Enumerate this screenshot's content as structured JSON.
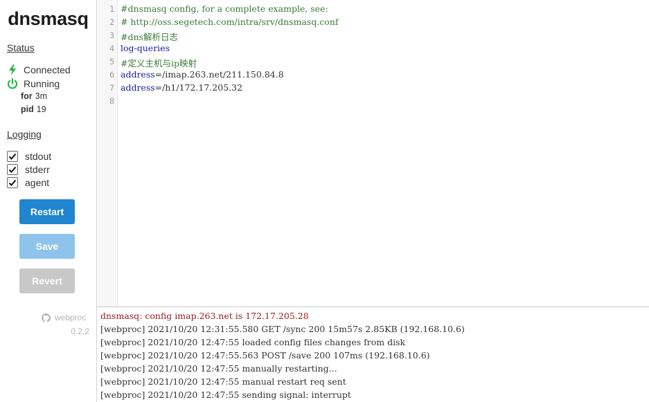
{
  "app": {
    "title": "dnsmasq"
  },
  "status": {
    "heading": "Status",
    "connected": "Connected",
    "running": "Running",
    "for_label": "for",
    "for_value": "3m",
    "pid_label": "pid",
    "pid_value": "19"
  },
  "logging": {
    "heading": "Logging",
    "options": [
      {
        "label": "stdout",
        "checked": true
      },
      {
        "label": "stderr",
        "checked": true
      },
      {
        "label": "agent",
        "checked": true
      }
    ]
  },
  "buttons": {
    "restart": "Restart",
    "save": "Save",
    "revert": "Revert"
  },
  "footer": {
    "brand": "webproc",
    "version": "0.2.2"
  },
  "colors": {
    "primary": "#2185d0",
    "primary_disabled": "#8ec4ec",
    "disabled": "#c8c8c8",
    "connected_icon": "#21ba45",
    "running_icon": "#21ba45"
  },
  "editor": {
    "line_numbers": [
      "1",
      "2",
      "3",
      "4",
      "5",
      "6",
      "7",
      "8"
    ],
    "lines": {
      "l1": "#dnsmasq config, for a complete example, see:",
      "l2": "# http://oss.segetech.com/intra/srv/dnsmasq.conf",
      "l3": "#dns解析日志",
      "l4": "log-queries",
      "l5": "#定义主机与ip映射",
      "l6_key": "address",
      "l6_val": "=/imap.263.net/211.150.84.8",
      "l7_key": "address",
      "l7_val": "=/h1/172.17.205.32",
      "l8": ""
    }
  },
  "log": {
    "lines": [
      "dnsmasq: config imap.263.net is 172.17.205.28",
      "[webproc] 2021/10/20 12:31:55.580 GET /sync 200 15m57s 2.85KB (192.168.10.6)",
      "[webproc] 2021/10/20 12:47:55 loaded config files changes from disk",
      "[webproc] 2021/10/20 12:47:55.563 POST /save 200 107ms (192.168.10.6)",
      "[webproc] 2021/10/20 12:47:55 manually restarting...",
      "[webproc] 2021/10/20 12:47:55 manual restart req sent",
      "[webproc] 2021/10/20 12:47:55 sending signal: interrupt"
    ]
  }
}
